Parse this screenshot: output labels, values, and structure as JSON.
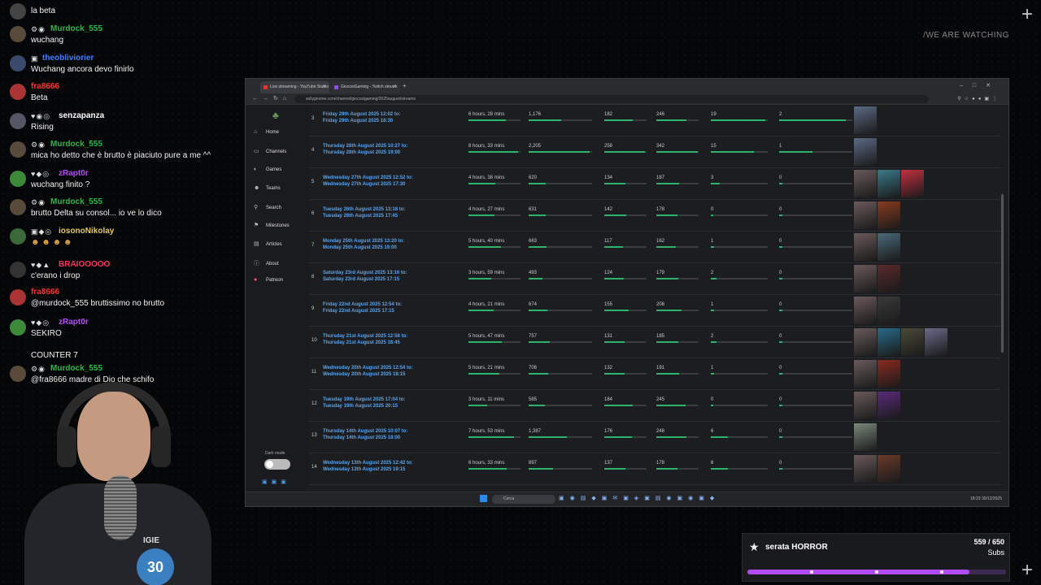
{
  "overlay": {
    "watching": "/WE ARE WATCHING"
  },
  "chat": [
    {
      "user": "",
      "text": "la beta",
      "color": "#ffffff",
      "badges": ""
    },
    {
      "user": "Murdock_555",
      "text": "wuchang",
      "color": "#1fbf3f",
      "badges": "⚙◉"
    },
    {
      "user": "theobliviorier",
      "text": "Wuchang ancora devo finirlo",
      "color": "#3f7fff",
      "badges": "▣"
    },
    {
      "user": "fra8666",
      "text": "Beta",
      "color": "#ff3030",
      "badges": ""
    },
    {
      "user": "senzapanza",
      "text": "Rising",
      "color": "#ffffff",
      "badges": "♥◉◎"
    },
    {
      "user": "Murdock_555",
      "text": "mica ho detto che è brutto è piaciuto pure a me ^^",
      "color": "#1fbf3f",
      "badges": "⚙◉"
    },
    {
      "user": "zRapt0r",
      "text": "wuchang finito ?",
      "color": "#b24bf3",
      "badges": "♥◆◎"
    },
    {
      "user": "Murdock_555",
      "text": "brutto Delta su consol... io ve lo dico",
      "color": "#1fbf3f",
      "badges": "⚙◉"
    },
    {
      "user": "iosonoNikolay",
      "text": "",
      "color": "#e6c85a",
      "badges": "▣◆◎"
    },
    {
      "user": "BRAIOOOOO",
      "text": "c'erano i drop",
      "color": "#ff3060",
      "badges": "♥◆▲"
    },
    {
      "user": "fra8666",
      "text": "@murdock_555 bruttissimo no brutto",
      "color": "#ff3030",
      "badges": ""
    },
    {
      "user": "zRapt0r",
      "text": "SEKIRO",
      "color": "#b24bf3",
      "badges": "♥◆◎"
    },
    {
      "user": "",
      "text": "COUNTER 7",
      "color": "#ffffff",
      "badges": ""
    },
    {
      "user": "Murdock_555",
      "text": "@fra8666 madre di Dio che schifo",
      "color": "#1fbf3f",
      "badges": "⚙◉"
    }
  ],
  "browser": {
    "tabs": [
      "Live streaming - YouTube Studio",
      "GiocosiGaming - Twitch stream"
    ],
    "url": "sullygnome.com/channel/giocosigaming/2025august/streams",
    "sidebar": [
      "Home",
      "Channels",
      "Games",
      "Teams",
      "Search",
      "Milestones",
      "Articles",
      "About",
      "Patreon"
    ],
    "dark_mode_label": "Dark mode",
    "search_label": "Cerca",
    "tray_time": "18:23",
    "tray_date": "30/12/2025"
  },
  "streams": [
    {
      "num": "3",
      "date1": "Friday 29th August 2025 12:02 to:",
      "date2": "Friday 29th August 2025 18:30",
      "duration": "6 hours, 28 mins",
      "c1": "1,176",
      "c2": "182",
      "c3": "246",
      "c4": "19",
      "c5": "2"
    },
    {
      "num": "4",
      "date1": "Thursday 28th August 2025 10:27 to:",
      "date2": "Thursday 28th August 2025 19:00",
      "duration": "8 hours, 33 mins",
      "c1": "2,205",
      "c2": "258",
      "c3": "342",
      "c4": "15",
      "c5": "1"
    },
    {
      "num": "5",
      "date1": "Wednesday 27th August 2025 12:52 to:",
      "date2": "Wednesday 27th August 2025 17:30",
      "duration": "4 hours, 38 mins",
      "c1": "620",
      "c2": "134",
      "c3": "187",
      "c4": "3",
      "c5": "0"
    },
    {
      "num": "6",
      "date1": "Tuesday 26th August 2025 13:18 to:",
      "date2": "Tuesday 26th August 2025 17:45",
      "duration": "4 hours, 27 mins",
      "c1": "631",
      "c2": "142",
      "c3": "178",
      "c4": "0",
      "c5": "0"
    },
    {
      "num": "7",
      "date1": "Monday 25th August 2025 13:20 to:",
      "date2": "Monday 25th August 2025 19:00",
      "duration": "5 hours, 40 mins",
      "c1": "663",
      "c2": "117",
      "c3": "162",
      "c4": "1",
      "c5": "0"
    },
    {
      "num": "8",
      "date1": "Saturday 23rd August 2025 13:16 to:",
      "date2": "Saturday 23rd August 2025 17:15",
      "duration": "3 hours, 59 mins",
      "c1": "493",
      "c2": "124",
      "c3": "179",
      "c4": "2",
      "c5": "0"
    },
    {
      "num": "9",
      "date1": "Friday 22nd August 2025 12:54 to:",
      "date2": "Friday 22nd August 2025 17:15",
      "duration": "4 hours, 21 mins",
      "c1": "674",
      "c2": "155",
      "c3": "208",
      "c4": "1",
      "c5": "0"
    },
    {
      "num": "10",
      "date1": "Thursday 21st August 2025 12:58 to:",
      "date2": "Thursday 21st August 2025 18:45",
      "duration": "5 hours, 47 mins",
      "c1": "757",
      "c2": "131",
      "c3": "185",
      "c4": "2",
      "c5": "0"
    },
    {
      "num": "11",
      "date1": "Wednesday 20th August 2025 12:54 to:",
      "date2": "Wednesday 20th August 2025 18:15",
      "duration": "5 hours, 21 mins",
      "c1": "706",
      "c2": "132",
      "c3": "191",
      "c4": "1",
      "c5": "0"
    },
    {
      "num": "12",
      "date1": "Tuesday 19th August 2025 17:04 to:",
      "date2": "Tuesday 19th August 2025 20:15",
      "duration": "3 hours, 11 mins",
      "c1": "585",
      "c2": "184",
      "c3": "245",
      "c4": "0",
      "c5": "0"
    },
    {
      "num": "13",
      "date1": "Thursday 14th August 2025 10:07 to:",
      "date2": "Thursday 14th August 2025 18:00",
      "duration": "7 hours, 53 mins",
      "c1": "1,387",
      "c2": "176",
      "c3": "248",
      "c4": "6",
      "c5": "0"
    },
    {
      "num": "14",
      "date1": "Wednesday 13th August 2025 12:42 to:",
      "date2": "Wednesday 13th August 2025 19:15",
      "duration": "6 hours, 33 mins",
      "c1": "897",
      "c2": "137",
      "c3": "178",
      "c4": "6",
      "c5": "0"
    }
  ],
  "thumb_colors": [
    [
      "#5a6b85"
    ],
    [
      "#5a6b85"
    ],
    [
      "#6a5a5a",
      "#3a7a8a",
      "#c23040"
    ],
    [
      "#6a5a5a",
      "#8a3a20"
    ],
    [
      "#6a5a5a",
      "#4a6a7a"
    ],
    [
      "#6a5a5a",
      "#5a2a2a"
    ],
    [
      "#6a5a5a",
      "#3a3a3a"
    ],
    [
      "#6a5a5a",
      "#2a6a8a",
      "#4a4a3a",
      "#6a6a8a"
    ],
    [
      "#6a5a5a",
      "#8a2a20"
    ],
    [
      "#6a5a5a",
      "#5a2a7a"
    ],
    [
      "#7a8a7a"
    ],
    [
      "#6a5a5a",
      "#6a3a2a"
    ]
  ],
  "goal": {
    "title": "serata HORROR",
    "count": "559 / 650",
    "unit": "Subs",
    "progress": 0.86,
    "color": "#b24bf3"
  },
  "webcam": {
    "shirt_text": "IGIE",
    "badge": "30"
  }
}
